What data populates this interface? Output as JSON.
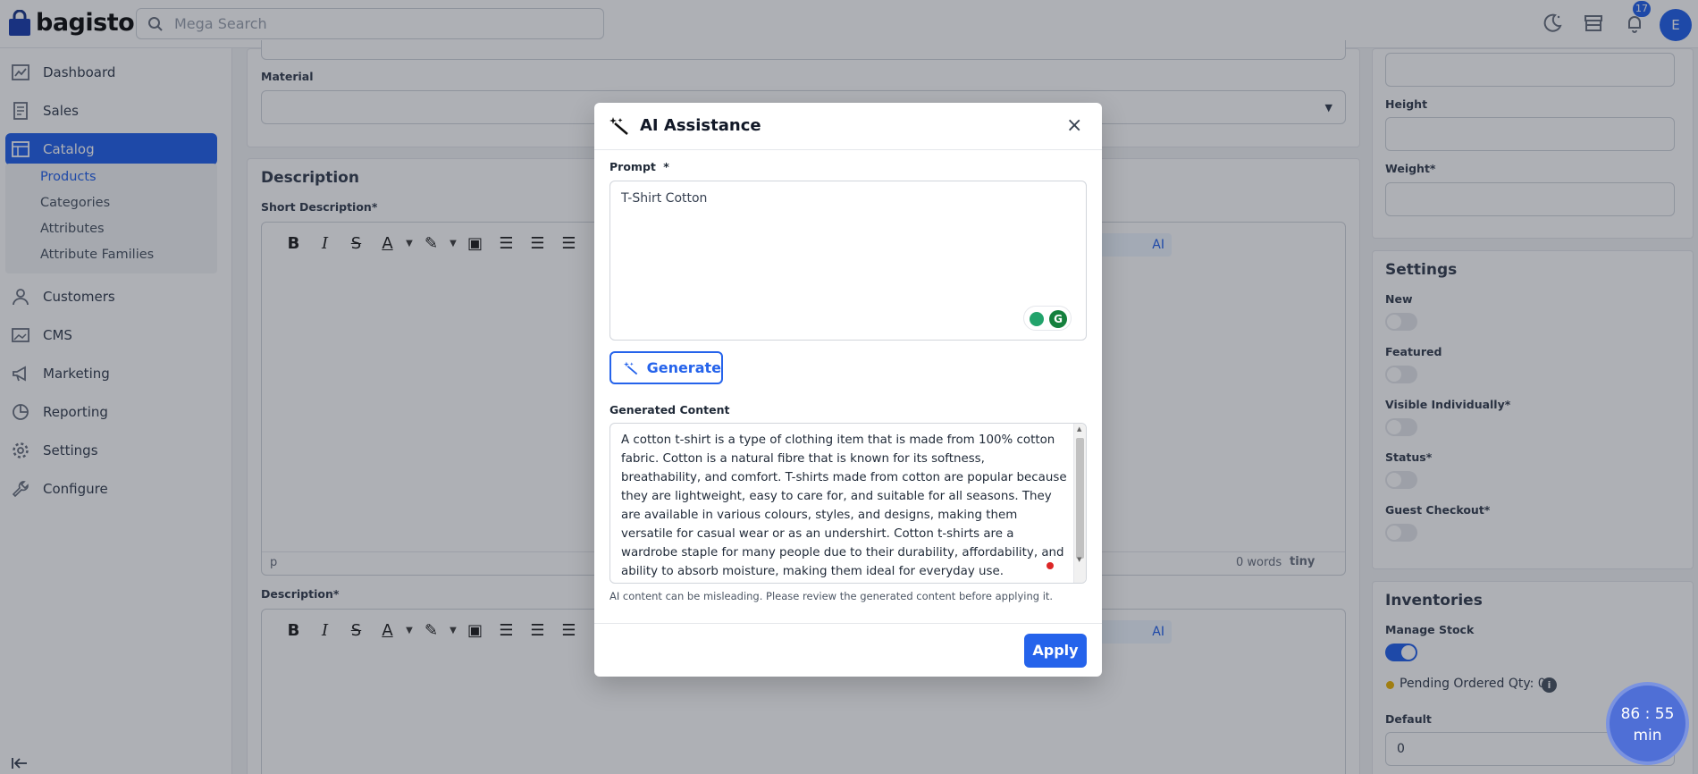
{
  "header": {
    "logo_text": "bagisto",
    "search_placeholder": "Mega Search",
    "notification_count": "17",
    "avatar_initial": "E"
  },
  "sidebar": {
    "items": [
      {
        "label": "Dashboard",
        "icon": "dashboard-icon"
      },
      {
        "label": "Sales",
        "icon": "receipt-icon"
      },
      {
        "label": "Catalog",
        "icon": "catalog-icon"
      },
      {
        "label": "Customers",
        "icon": "user-icon"
      },
      {
        "label": "CMS",
        "icon": "image-icon"
      },
      {
        "label": "Marketing",
        "icon": "megaphone-icon"
      },
      {
        "label": "Reporting",
        "icon": "chart-pie-icon"
      },
      {
        "label": "Settings",
        "icon": "gear-icon"
      },
      {
        "label": "Configure",
        "icon": "wrench-icon"
      }
    ],
    "catalog_sub": [
      "Products",
      "Categories",
      "Attributes",
      "Attribute Families"
    ]
  },
  "main": {
    "material_label": "Material",
    "description_title": "Description",
    "short_description_label": "Short Description*",
    "description_label": "Description*",
    "ai_button_label": "AI",
    "status_path": "p",
    "word_count": "0 words",
    "tiny_brand": "tiny"
  },
  "right": {
    "height_label": "Height",
    "weight_label": "Weight*",
    "settings_title": "Settings",
    "settings": [
      {
        "label": "New",
        "on": false
      },
      {
        "label": "Featured",
        "on": false
      },
      {
        "label": "Visible Individually*",
        "on": false
      },
      {
        "label": "Status*",
        "on": false
      },
      {
        "label": "Guest Checkout*",
        "on": false
      }
    ],
    "inventories_title": "Inventories",
    "manage_stock_label": "Manage Stock",
    "manage_stock_on": true,
    "pending_label": "Pending Ordered Qty: 0",
    "default_label": "Default",
    "default_value": "0"
  },
  "modal": {
    "title": "AI Assistance",
    "prompt_label": "Prompt",
    "prompt_required": "*",
    "prompt_value": "T-Shirt Cotton",
    "generate_label": "Generate",
    "generated_label": "Generated Content",
    "generated_text": "A cotton t-shirt is a type of clothing item that is made from 100% cotton fabric. Cotton is a natural fibre that is known for its softness, breathability, and comfort. T-shirts made from cotton are popular because they are lightweight, easy to care for, and suitable for all seasons. They are available in various colours, styles, and designs, making them versatile for casual wear or as an undershirt. Cotton t-shirts are a wardrobe staple for many people due to their durability, affordability, and ability to absorb moisture, making them ideal for everyday use.",
    "disclaimer": "AI content can be misleading. Please review the generated content before applying it.",
    "apply_label": "Apply"
  },
  "timer": {
    "value": "86 : 55",
    "unit": "min"
  },
  "colors": {
    "accent": "#2563eb"
  }
}
